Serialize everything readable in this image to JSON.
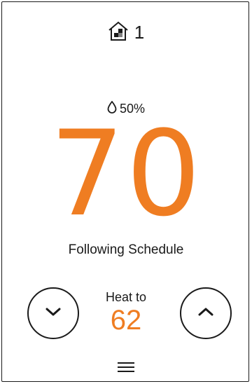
{
  "zone": {
    "icon": "house-zone-icon",
    "label": "1"
  },
  "humidity": {
    "icon": "droplet-icon",
    "value": "50%"
  },
  "current_temperature": "70",
  "status": "Following Schedule",
  "setpoint": {
    "label": "Heat to",
    "value": "62"
  },
  "controls": {
    "decrease_icon": "chevron-down-icon",
    "increase_icon": "chevron-up-icon",
    "menu_icon": "menu-icon"
  },
  "colors": {
    "accent": "#ef7d22",
    "text": "#1a1a1a",
    "background": "#ffffff"
  }
}
